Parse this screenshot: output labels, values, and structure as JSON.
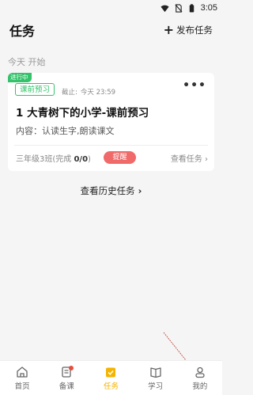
{
  "status_bar": {
    "time": "3:05"
  },
  "header": {
    "title": "任务",
    "publish_label": "发布任务"
  },
  "section": {
    "date_label": "今天 开始"
  },
  "task_card": {
    "status_tag": "进行中",
    "type_tag": "课前预习",
    "deadline_prefix": "截止:",
    "deadline_time": "今天 23:59",
    "title": "1 大青树下的小学-课前预习",
    "content": "内容：认读生字,朗读课文",
    "class_prefix": "三年级3班(完成 ",
    "completion": "0/0",
    "class_suffix": ")",
    "remind_label": "提醒",
    "view_label": "查看任务"
  },
  "history_label": "查看历史任务",
  "colors": {
    "accent_green": "#34c26b",
    "remind_red": "#f06a6a",
    "active_nav": "#f5b400"
  },
  "bottom_nav": {
    "items": [
      {
        "label": "首页",
        "icon": "home-icon"
      },
      {
        "label": "备课",
        "icon": "notebook-icon"
      },
      {
        "label": "任务",
        "icon": "task-check-icon"
      },
      {
        "label": "学习",
        "icon": "book-icon"
      },
      {
        "label": "我的",
        "icon": "user-icon"
      }
    ],
    "active_index": 2
  }
}
